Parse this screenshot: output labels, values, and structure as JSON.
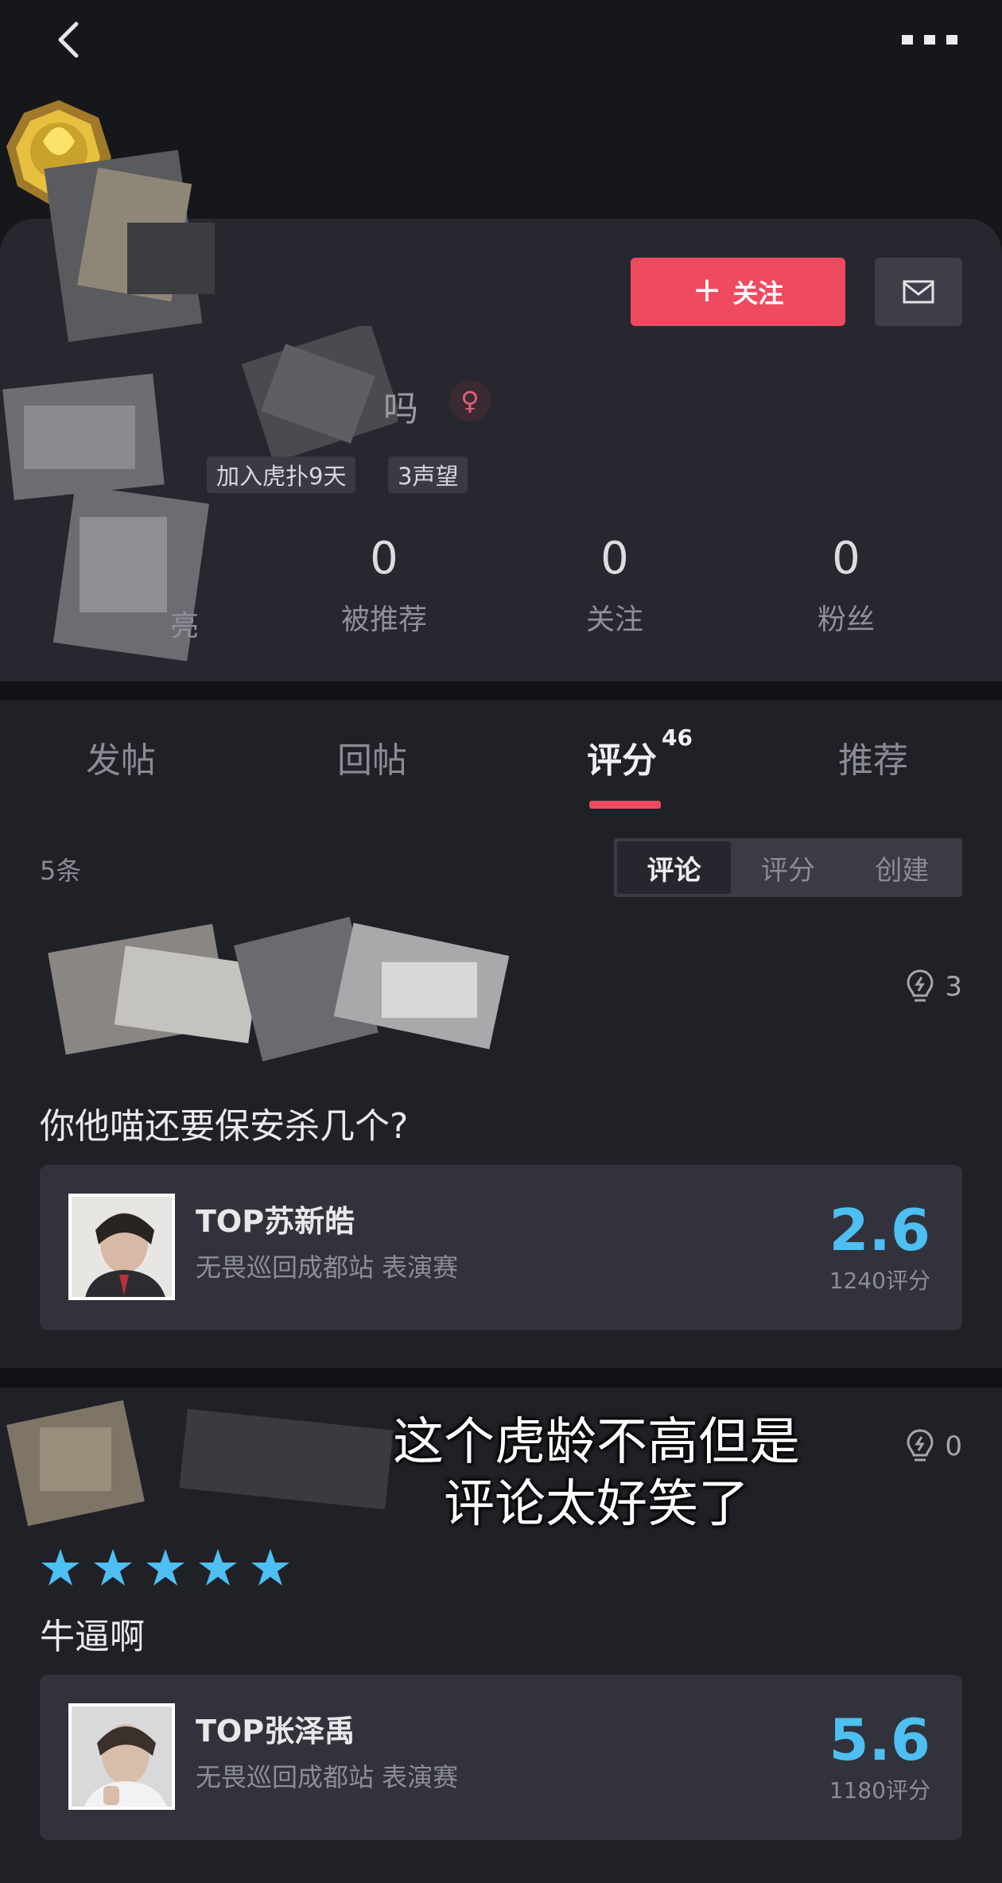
{
  "nav": {
    "back_icon": "chevron-left-icon",
    "more_icon": "more-dots-icon"
  },
  "profile": {
    "follow_label": "关注",
    "follow_plus": "+",
    "name_fragment": "吗",
    "gender_symbol": "♀",
    "tags": {
      "joined": "加入虎扑9天",
      "reputation": "3声望"
    },
    "stats": [
      {
        "label": "亮",
        "value": ""
      },
      {
        "label": "被推荐",
        "value": "0"
      },
      {
        "label": "关注",
        "value": "0"
      },
      {
        "label": "粉丝",
        "value": "0"
      }
    ],
    "colors": {
      "follow": "#ef4a5f",
      "accent_blue": "#4dbff2"
    }
  },
  "tabs": [
    {
      "label": "发帖"
    },
    {
      "label": "回帖"
    },
    {
      "label": "评分",
      "badge": "46",
      "active": true
    },
    {
      "label": "推荐"
    }
  ],
  "filter": {
    "count": "5条",
    "segments": [
      {
        "label": "评论",
        "active": true
      },
      {
        "label": "评分"
      },
      {
        "label": "创建"
      }
    ]
  },
  "reviews": [
    {
      "likes": "3",
      "text": "你他喵还要保安杀几个?",
      "item": {
        "title": "TOP苏新皓",
        "subtitle": "无畏巡回成都站 表演赛",
        "score": "2.6",
        "count": "1240评分"
      }
    },
    {
      "likes": "0",
      "stars": 5,
      "text": "牛逼啊",
      "item": {
        "title": "TOP张泽禹",
        "subtitle": "无畏巡回成都站 表演赛",
        "score": "5.6",
        "count": "1180评分"
      }
    }
  ],
  "overlay_caption": {
    "line1": "这个虎龄不高但是",
    "line2": "评论太好笑了"
  }
}
